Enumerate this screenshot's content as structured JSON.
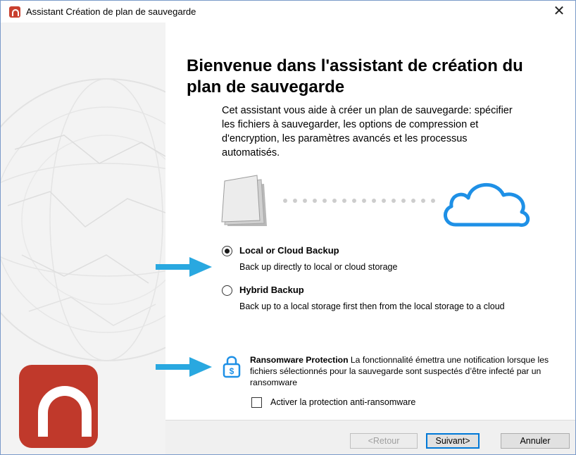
{
  "window": {
    "title": "Assistant Création de plan de sauvegarde",
    "close_glyph": "✕"
  },
  "main": {
    "heading": "Bienvenue dans l'assistant de création du plan de sauvegarde",
    "intro": "Cet assistant vous aide à créer un plan de sauvegarde: spécifier les fichiers à sauvegarder, les options de compression et d'encryption, les paramètres avancés et les processus automatisés."
  },
  "options": [
    {
      "title": "Local or Cloud Backup",
      "description": "Back up directly to local or cloud storage",
      "selected": true
    },
    {
      "title": "Hybrid Backup",
      "description": "Back up to a local storage first then from the local storage to a cloud",
      "selected": false
    }
  ],
  "ransomware": {
    "title": "Ransomware Protection",
    "text": " La fonctionnalité émettra une notification lorsque les fichiers sélectionnés pour la sauvegarde sont suspectés d’être infecté par un ransomware",
    "checkbox_label": "Activer la protection anti-ransomware",
    "checked": false
  },
  "footer": {
    "back_label": "<Retour",
    "next_label": "Suivant>",
    "cancel_label": "Annuler"
  },
  "icons": {
    "app": "app-logo-icon",
    "documents": "documents-icon",
    "cloud": "cloud-icon",
    "lock": "lock-dollar-icon",
    "arrows": "pointer-arrow-icon"
  },
  "colors": {
    "brand_red": "#c0392b",
    "cloud_blue": "#1e90e6",
    "arrow_blue": "#29a8e0",
    "primary_border": "#0078d7"
  }
}
